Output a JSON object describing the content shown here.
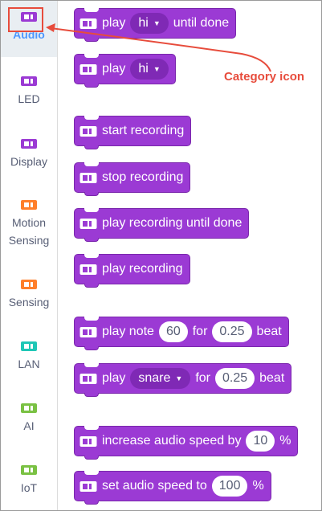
{
  "sidebar": {
    "categories": [
      {
        "label": "Audio",
        "icon": "audio-module-icon",
        "color": "#9b3ad4",
        "selected": true
      },
      {
        "label": "LED",
        "icon": "led-module-icon",
        "color": "#9b3ad4"
      },
      {
        "label": "Display",
        "icon": "display-module-icon",
        "color": "#9b3ad4"
      },
      {
        "label": "Motion Sensing",
        "icon": "motion-sensing-module-icon",
        "color": "#ff7f2a"
      },
      {
        "label": "Sensing",
        "icon": "sensing-module-icon",
        "color": "#ff7f2a"
      },
      {
        "label": "LAN",
        "icon": "lan-module-icon",
        "color": "#1fc7b6"
      },
      {
        "label": "AI",
        "icon": "ai-module-icon",
        "color": "#7ac143"
      },
      {
        "label": "IoT",
        "icon": "iot-module-icon",
        "color": "#7ac143"
      }
    ]
  },
  "annotation": {
    "text": "Category icon",
    "color": "#e74c3c"
  },
  "blocks": [
    {
      "parts": [
        {
          "t": "text",
          "v": "play"
        },
        {
          "t": "dropdown",
          "v": "hi"
        },
        {
          "t": "text",
          "v": "until done"
        }
      ]
    },
    {
      "parts": [
        {
          "t": "text",
          "v": "play"
        },
        {
          "t": "dropdown",
          "v": "hi"
        }
      ]
    },
    {
      "parts": [
        {
          "t": "text",
          "v": "start recording"
        }
      ]
    },
    {
      "parts": [
        {
          "t": "text",
          "v": "stop recording"
        }
      ]
    },
    {
      "parts": [
        {
          "t": "text",
          "v": "play recording until done"
        }
      ]
    },
    {
      "parts": [
        {
          "t": "text",
          "v": "play recording"
        }
      ]
    },
    {
      "parts": [
        {
          "t": "text",
          "v": "play note"
        },
        {
          "t": "number",
          "v": "60"
        },
        {
          "t": "text",
          "v": "for"
        },
        {
          "t": "number",
          "v": "0.25"
        },
        {
          "t": "text",
          "v": "beat"
        }
      ]
    },
    {
      "parts": [
        {
          "t": "text",
          "v": "play"
        },
        {
          "t": "dropdown",
          "v": "snare"
        },
        {
          "t": "text",
          "v": "for"
        },
        {
          "t": "number",
          "v": "0.25"
        },
        {
          "t": "text",
          "v": "beat"
        }
      ]
    },
    {
      "parts": [
        {
          "t": "text",
          "v": "increase audio speed by"
        },
        {
          "t": "number",
          "v": "10"
        },
        {
          "t": "text",
          "v": "%"
        }
      ]
    },
    {
      "parts": [
        {
          "t": "text",
          "v": "set audio speed to"
        },
        {
          "t": "number",
          "v": "100"
        },
        {
          "t": "text",
          "v": "%"
        }
      ]
    }
  ],
  "colors": {
    "block": "#9b3ad4",
    "block_border": "#7a27ac",
    "dropdown": "#7f29b5",
    "selected_label": "#4c97ff"
  }
}
